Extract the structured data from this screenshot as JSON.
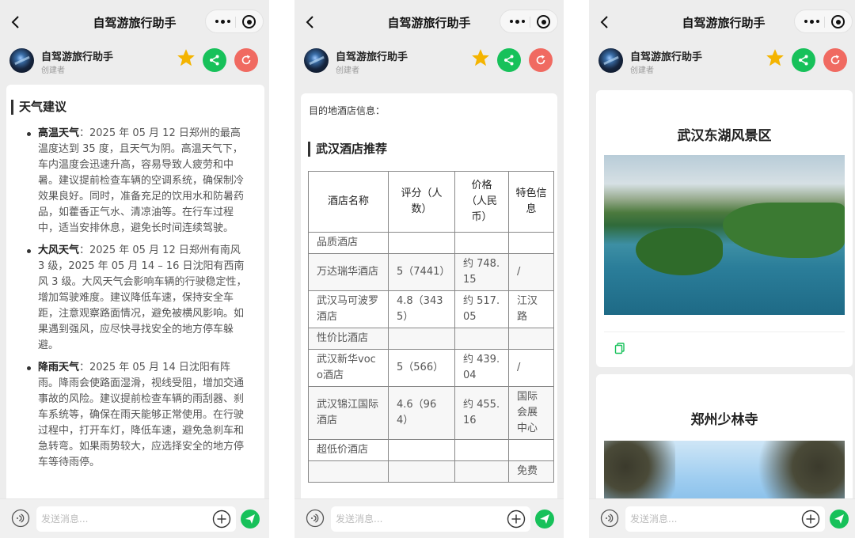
{
  "nav": {
    "title": "自驾游旅行助手"
  },
  "header": {
    "name": "自驾游旅行助手",
    "role": "创建者"
  },
  "weather": {
    "title": "天气建议",
    "items": [
      {
        "label": "高温天气",
        "text": "：2025 年 05 月 12 日郑州的最高温度达到 35 度，且天气为阴。高温天气下，车内温度会迅速升高，容易导致人疲劳和中暑。建议提前检查车辆的空调系统，确保制冷效果良好。同时，准备充足的饮用水和防暑药品，如藿香正气水、清凉油等。在行车过程中，适当安排休息，避免长时间连续驾驶。"
      },
      {
        "label": "大风天气",
        "text": "：2025 年 05 月 12 日郑州有南风 3 级，2025 年 05 月 14 – 16 日沈阳有西南风 3 级。大风天气会影响车辆的行驶稳定性，增加驾驶难度。建议降低车速，保持安全车距，注意观察路面情况，避免被横风影响。如果遇到强风，应尽快寻找安全的地方停车躲避。"
      },
      {
        "label": "降雨天气",
        "text": "：2025 年 05 月 14 日沈阳有阵雨。降雨会使路面湿滑，视线受阻，增加交通事故的风险。建议提前检查车辆的雨刮器、刹车系统等，确保在雨天能够正常使用。在行驶过程中，打开车灯，降低车速，避免急刹车和急转弯。如果雨势较大，应选择安全的地方停车等待雨停。"
      }
    ]
  },
  "hotel": {
    "intro": "目的地酒店信息：",
    "title": "武汉酒店推荐",
    "headers": [
      "酒店名称",
      "评分（人数）",
      "价格（人民币）",
      "特色信息"
    ],
    "rows": [
      [
        "品质酒店",
        "",
        "",
        ""
      ],
      [
        "万达瑞华酒店",
        "5（7441）",
        "约 748.15",
        "/"
      ],
      [
        "武汉马可波罗酒店",
        "4.8（3435）",
        "约 517.05",
        "江汉路"
      ],
      [
        "性价比酒店",
        "",
        "",
        ""
      ],
      [
        "武汉新华voco酒店",
        "5（566）",
        "约 439.04",
        "/"
      ],
      [
        "武汉锦江国际酒店",
        "4.6（964）",
        "约 455.16",
        "国际会展中心"
      ],
      [
        "超低价酒店",
        "",
        "",
        ""
      ],
      [
        "",
        "",
        "",
        "免费"
      ]
    ]
  },
  "scenic": [
    {
      "title": "武汉东湖风景区"
    },
    {
      "title": "郑州少林寺"
    }
  ],
  "input": {
    "placeholder": "发送消息..."
  },
  "colors": {
    "green": "#17c15a",
    "red": "#f06a61",
    "star": "#f4b400"
  }
}
